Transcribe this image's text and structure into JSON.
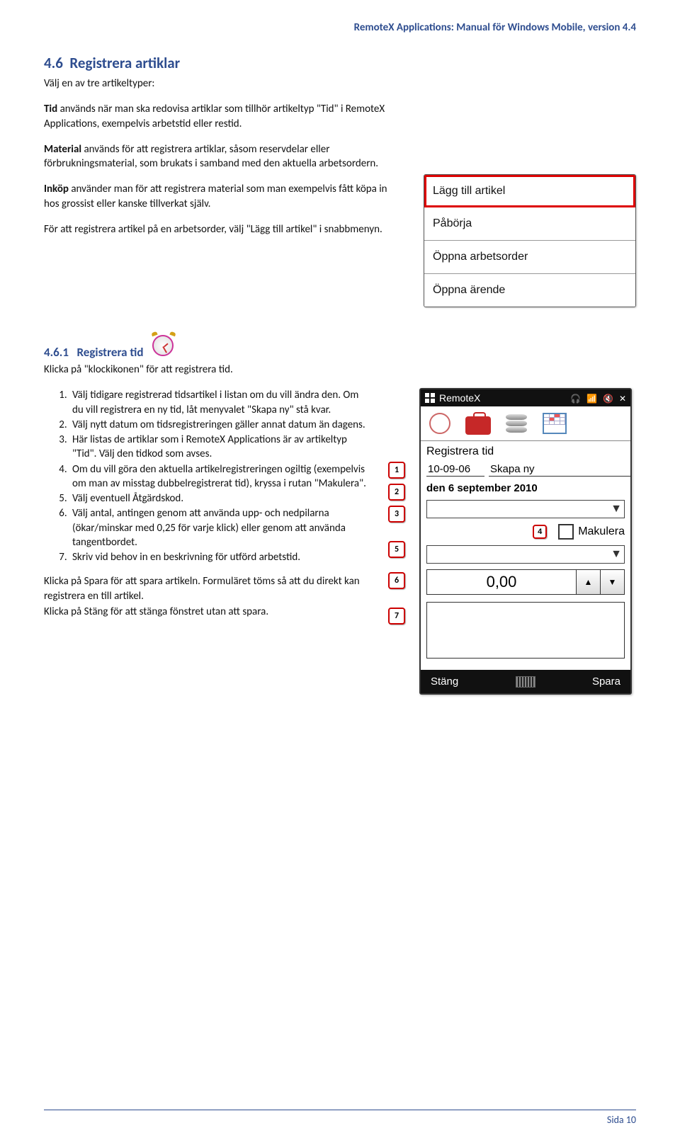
{
  "header": {
    "title": "RemoteX Applications: Manual för Windows Mobile, version 4.4"
  },
  "section": {
    "number": "4.6",
    "title": "Registrera artiklar",
    "intro": "Välj en av tre artikeltyper:",
    "p_tid_bold": "Tid",
    "p_tid": " används när man ska redovisa artiklar som tillhör artikeltyp \"Tid\" i RemoteX Applications, exempelvis arbetstid eller restid.",
    "p_mat_bold": "Material",
    "p_mat": " används för att registrera artiklar, såsom reservdelar eller förbrukningsmaterial, som brukats i samband med den aktuella arbetsordern.",
    "p_ink_bold": "Inköp",
    "p_ink": " använder man för att registrera material som man exempelvis fått köpa in hos grossist eller kanske tillverkat själv.",
    "p_reg": "För att registrera artikel på en arbetsorder, välj \"Lägg till artikel\" i snabbmenyn."
  },
  "menu": {
    "items": [
      "Lägg till artikel",
      "Påbörja",
      "Öppna arbetsorder",
      "Öppna ärende"
    ]
  },
  "subsection": {
    "number": "4.6.1",
    "title": "Registrera tid",
    "intro": "Klicka på \"klockikonen\" för att registrera tid.",
    "steps": [
      "Välj tidigare registrerad tidsartikel i listan om du vill ändra den. Om du vill registrera en ny tid, låt menyvalet \"Skapa ny\" stå kvar.",
      "Välj nytt datum om tidsregistreringen gäller annat datum än dagens.",
      "Här listas de artiklar som i RemoteX Applications är av artikeltyp \"Tid\". Välj den tidkod som avses.",
      "Om du vill göra den aktuella artikelregistreringen ogiltig (exempelvis om man av misstag dubbelregistrerat tid), kryssa i rutan \"Makulera\".",
      "Välj eventuell Åtgärdskod.",
      "Välj antal, antingen genom att använda upp- och nedpilarna (ökar/minskar med 0,25 för varje klick) eller genom att använda tangentbordet.",
      "Skriv vid behov in en beskrivning för utförd arbetstid."
    ],
    "outro1": "Klicka på Spara för att spara artikeln. Formuläret töms så att du direkt kan registrera en till artikel.",
    "outro2": "Klicka på Stäng för att stänga fönstret utan att spara."
  },
  "device": {
    "title": "RemoteX",
    "body_label": "Registrera tid",
    "date": "10-09-06",
    "create": "Skapa ny",
    "weekday": "den 6 september 2010",
    "makulera": "Makulera",
    "qty": "0,00",
    "close": "Stäng",
    "save": "Spara"
  },
  "callouts": [
    "1",
    "2",
    "3",
    "4",
    "5",
    "6",
    "7"
  ],
  "footer": {
    "page": "Sida 10"
  }
}
